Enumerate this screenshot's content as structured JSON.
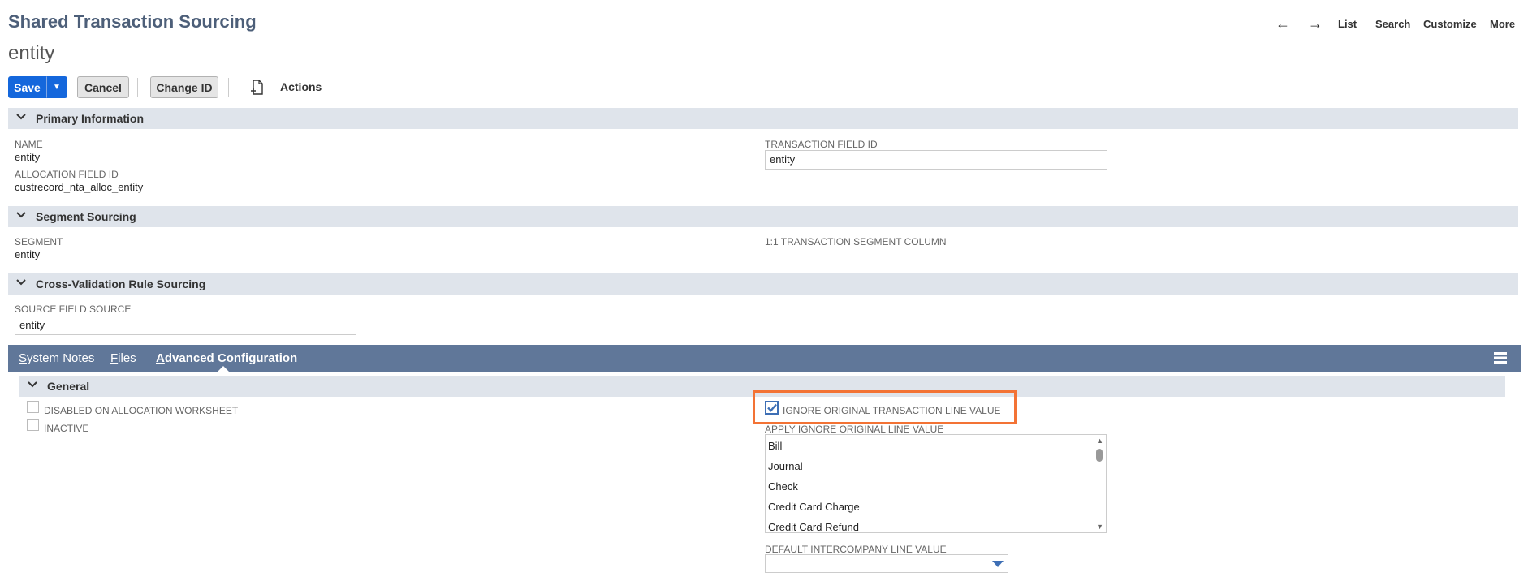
{
  "header": {
    "title": "Shared Transaction Sourcing",
    "record_name": "entity",
    "nav": {
      "back_icon": "←",
      "forward_icon": "→",
      "list": "List",
      "search": "Search",
      "customize": "Customize",
      "more": "More"
    }
  },
  "toolbar": {
    "save": "Save",
    "save_dropdown_icon": "▼",
    "cancel": "Cancel",
    "change_id": "Change ID",
    "actions": "Actions"
  },
  "primary_information": {
    "section_title": "Primary Information",
    "name_label": "NAME",
    "name_value": "entity",
    "allocation_label": "ALLOCATION FIELD ID",
    "allocation_value": "custrecord_nta_alloc_entity",
    "transaction_field_label": "TRANSACTION FIELD ID",
    "transaction_field_value": "entity"
  },
  "segment_sourcing": {
    "section_title": "Segment Sourcing",
    "segment_label": "SEGMENT",
    "segment_value": "entity",
    "column_label": "1:1 TRANSACTION SEGMENT COLUMN"
  },
  "cross_validation": {
    "section_title": "Cross-Validation Rule Sourcing",
    "source_label": "SOURCE FIELD SOURCE",
    "source_value": "entity"
  },
  "tabs": {
    "system_notes_first": "S",
    "system_notes_rest": "ystem Notes",
    "files_first": "F",
    "files_rest": "iles",
    "advanced_first": "A",
    "advanced_rest": "dvanced Configuration"
  },
  "general": {
    "section_title": "General",
    "disabled_label": "DISABLED ON ALLOCATION WORKSHEET",
    "disabled_checked": false,
    "inactive_label": "INACTIVE",
    "inactive_checked": false,
    "ignore_label": "IGNORE ORIGINAL TRANSACTION LINE VALUE",
    "ignore_checked": true,
    "apply_label": "APPLY IGNORE ORIGINAL LINE VALUE",
    "apply_options": [
      "Bill",
      "Journal",
      "Check",
      "Credit Card Charge",
      "Credit Card Refund"
    ],
    "default_intercompany_label": "DEFAULT INTERCOMPANY LINE VALUE",
    "default_intercompany_value": ""
  },
  "colors": {
    "primary_button": "#1467dc",
    "tab_bar": "#607799",
    "section_bg": "#dfe4eb",
    "highlight": "#f37335",
    "title": "#4d5f79"
  }
}
